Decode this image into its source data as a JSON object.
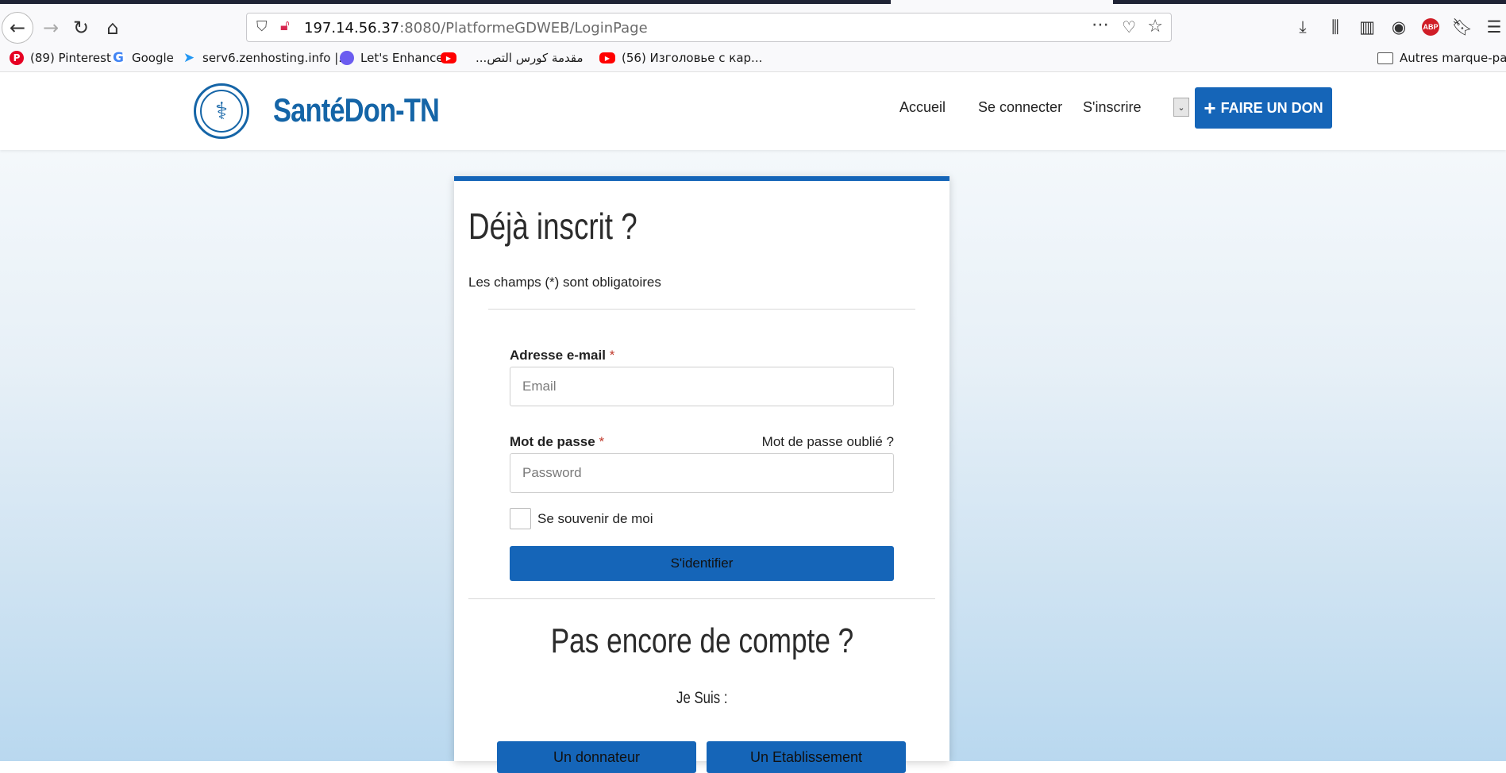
{
  "browser": {
    "url_host": "197.14.56.37",
    "url_path": ":8080/PlatformeGDWEB/LoginPage",
    "bookmarks": [
      {
        "label": "(89) Pinterest",
        "icon": "pinterest-icon"
      },
      {
        "label": "Google",
        "icon": "google-icon"
      },
      {
        "label": "serv6.zenhosting.info |...",
        "icon": "zenhosting-icon"
      },
      {
        "label": "Let's Enhance",
        "icon": "letsenhance-icon"
      },
      {
        "label": "...مقدمة كورس التص",
        "icon": "youtube-icon"
      },
      {
        "label": "(56) Изголовье с кар...",
        "icon": "youtube-icon"
      }
    ],
    "other_bookmarks": "Autres marque-pages"
  },
  "header": {
    "brand": "SantéDon-TN",
    "menu": {
      "home": "Accueil",
      "login": "Se connecter",
      "signup": "S'inscrire"
    },
    "donate_label": "FAIRE UN DON",
    "brand_color": "#1565b8"
  },
  "login": {
    "title": "Déjà inscrit ?",
    "required_note": "Les champs (*) sont obligatoires",
    "email_label": "Adresse e-mail",
    "email_placeholder": "Email",
    "password_label": "Mot de passe",
    "password_placeholder": "Password",
    "required_mark": "*",
    "forgot": "Mot de passe oublié ?",
    "remember": "Se souvenir de moi",
    "submit": "S'identifier"
  },
  "signup": {
    "title": "Pas encore de compte ?",
    "je_suis": "Je Suis :",
    "donor": "Un donnateur",
    "establishment": "Un Etablissement"
  }
}
